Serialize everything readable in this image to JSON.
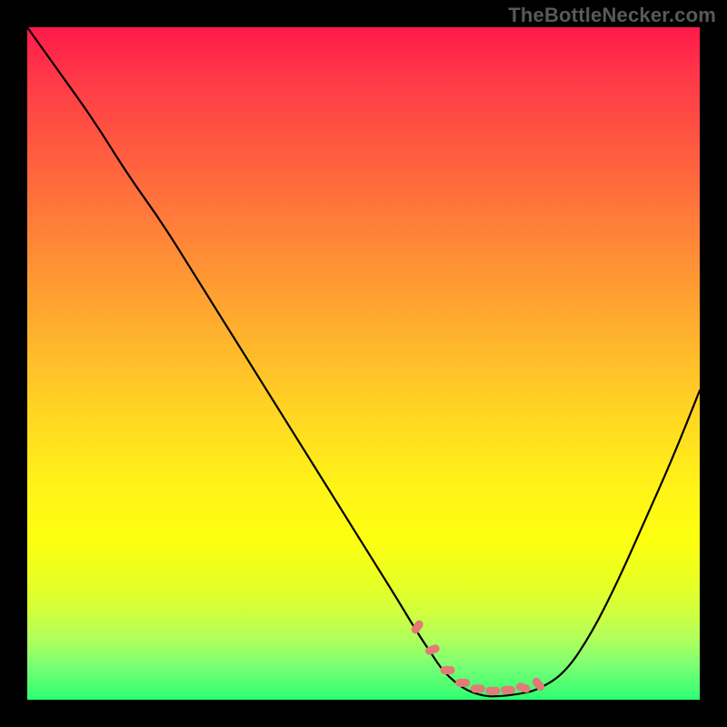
{
  "watermark": "TheBottleNecker.com",
  "colors": {
    "curve": "#000000",
    "dash": "#e27a78",
    "black_frame": "#000000"
  },
  "chart_data": {
    "type": "line",
    "title": "",
    "xlabel": "",
    "ylabel": "",
    "xlim": [
      0,
      100
    ],
    "ylim": [
      0,
      100
    ],
    "curve": {
      "x": [
        0,
        5,
        10,
        15,
        20,
        25,
        30,
        35,
        40,
        45,
        50,
        55,
        58,
        60,
        62,
        65,
        68,
        70,
        73,
        76,
        80,
        84,
        88,
        92,
        96,
        100
      ],
      "y": [
        100,
        93,
        86,
        78,
        71,
        63,
        55,
        47,
        39,
        31,
        23,
        15,
        10,
        7,
        4,
        1.5,
        0.5,
        0.5,
        0.8,
        1.5,
        4,
        10,
        18,
        27,
        36,
        46
      ]
    },
    "flat_region": {
      "x_start": 58,
      "x_end": 76,
      "marker": "dashed-salmon"
    },
    "background": {
      "type": "vertical-gradient",
      "top_color": "#ff1a4b",
      "bottom_color": "#2cff72",
      "meaning": "bottleneck-severity (red=high, green=none)"
    }
  }
}
